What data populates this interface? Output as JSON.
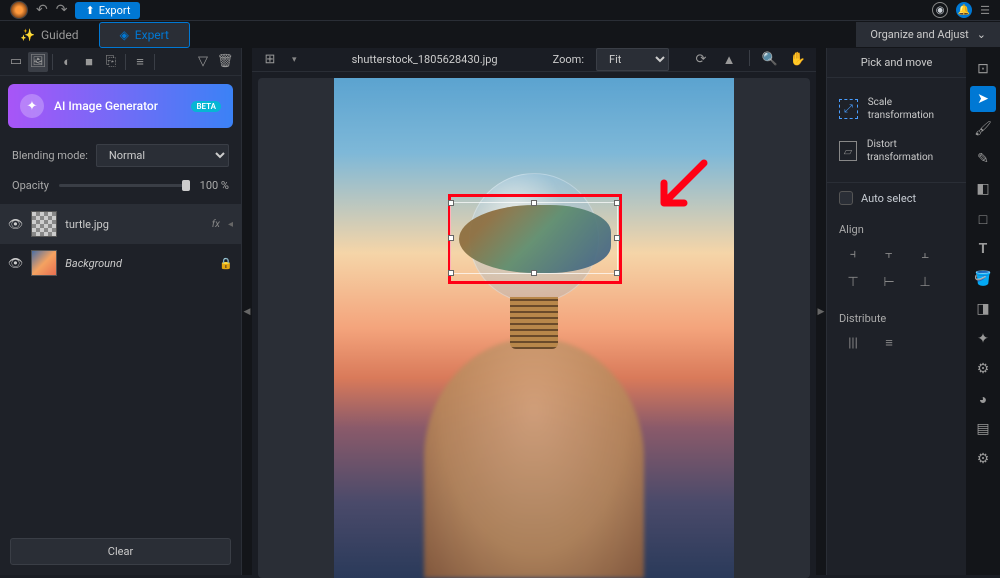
{
  "topbar": {
    "export_label": "Export"
  },
  "tabs": {
    "guided": "Guided",
    "expert": "Expert"
  },
  "organize_label": "Organize and Adjust",
  "left": {
    "ai_gen": "AI Image Generator",
    "beta": "BETA",
    "blending_mode_label": "Blending mode:",
    "blending_mode_value": "Normal",
    "opacity_label": "Opacity",
    "opacity_value": "100 %",
    "layers": [
      {
        "name": "turtle.jpg",
        "fx": "fx",
        "selected": true
      },
      {
        "name": "Background",
        "locked": true
      }
    ],
    "clear_label": "Clear"
  },
  "canvas": {
    "filename": "shutterstock_1805628430.jpg",
    "zoom_label": "Zoom:",
    "zoom_value": "Fit"
  },
  "right": {
    "title": "Pick and move",
    "scale": "Scale transformation",
    "distort": "Distort transformation",
    "auto_select": "Auto select",
    "align_label": "Align",
    "distribute_label": "Distribute"
  }
}
